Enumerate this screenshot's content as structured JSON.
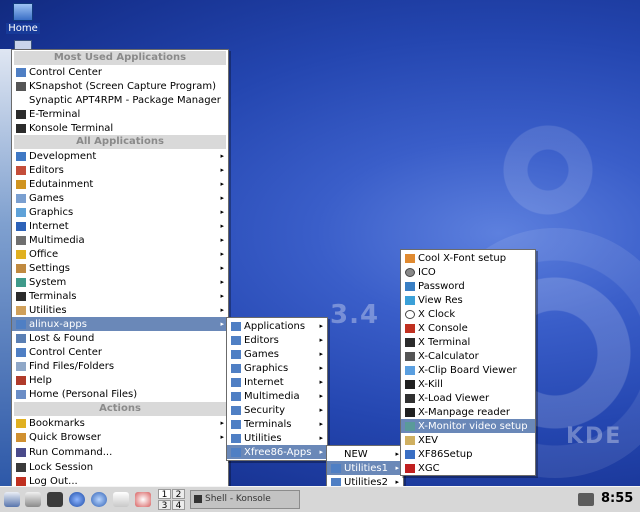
{
  "desktop": {
    "home_icon": "Home",
    "watermark_version": "3.4",
    "watermark_kde": "KDE",
    "brand_strip": "alinux"
  },
  "main_menu": {
    "most_used_title": "Most Used Applications",
    "most_used": [
      {
        "label": "Control Center",
        "icon": "control-center-icon"
      },
      {
        "label": "KSnapshot (Screen Capture Program)",
        "icon": "camera-icon"
      },
      {
        "label": "Synaptic APT4RPM - Package Manager",
        "icon": ""
      },
      {
        "label": "E-Terminal",
        "icon": "terminal-icon"
      },
      {
        "label": "Konsole Terminal",
        "icon": "terminal-icon"
      }
    ],
    "all_title": "All Applications",
    "all": [
      {
        "label": "Development",
        "icon": "development-icon"
      },
      {
        "label": "Editors",
        "icon": "editor-icon"
      },
      {
        "label": "Edutainment",
        "icon": "edutainment-icon"
      },
      {
        "label": "Games",
        "icon": "games-icon"
      },
      {
        "label": "Graphics",
        "icon": "graphics-icon"
      },
      {
        "label": "Internet",
        "icon": "internet-icon"
      },
      {
        "label": "Multimedia",
        "icon": "multimedia-icon"
      },
      {
        "label": "Office",
        "icon": "office-icon"
      },
      {
        "label": "Settings",
        "icon": "settings-icon"
      },
      {
        "label": "System",
        "icon": "system-icon"
      },
      {
        "label": "Terminals",
        "icon": "terminal-icon"
      },
      {
        "label": "Utilities",
        "icon": "utilities-icon"
      },
      {
        "label": "alinux-apps",
        "icon": "folder-icon"
      },
      {
        "label": "Lost & Found",
        "icon": "lost-found-icon"
      }
    ],
    "extra": [
      {
        "label": "Control Center",
        "icon": "control-center-icon"
      },
      {
        "label": "Find Files/Folders",
        "icon": "find-icon"
      },
      {
        "label": "Help",
        "icon": "help-icon"
      },
      {
        "label": "Home (Personal Files)",
        "icon": "home-icon"
      }
    ],
    "actions_title": "Actions",
    "actions": [
      {
        "label": "Bookmarks",
        "icon": "bookmark-icon"
      },
      {
        "label": "Quick Browser",
        "icon": "quick-browser-icon"
      },
      {
        "label": "Run Command...",
        "icon": "run-icon"
      },
      {
        "label": "Lock Session",
        "icon": "lock-icon"
      },
      {
        "label": "Log Out...",
        "icon": "logout-icon"
      }
    ]
  },
  "alinux_apps_menu": [
    "Applications",
    "Editors",
    "Games",
    "Graphics",
    "Internet",
    "Multimedia",
    "Security",
    "Terminals",
    "Utilities",
    "Xfree86-Apps"
  ],
  "xfree_menu": [
    "NEW",
    "Utilities1",
    "Utilities2"
  ],
  "utilities1_menu": [
    {
      "label": "Cool X-Font setup",
      "icon": "font-icon"
    },
    {
      "label": "ICO",
      "icon": "ico-icon"
    },
    {
      "label": "Password",
      "icon": "password-icon"
    },
    {
      "label": "View Res",
      "icon": "view-res-icon"
    },
    {
      "label": "X Clock",
      "icon": "clock-icon"
    },
    {
      "label": "X Console",
      "icon": "console-icon"
    },
    {
      "label": "X Terminal",
      "icon": "terminal-icon"
    },
    {
      "label": "X-Calculator",
      "icon": "calculator-icon"
    },
    {
      "label": "X-Clip Board Viewer",
      "icon": "clipboard-icon"
    },
    {
      "label": "X-Kill",
      "icon": "skull-icon"
    },
    {
      "label": "X-Load Viewer",
      "icon": "load-icon"
    },
    {
      "label": "X-Manpage reader",
      "icon": "manpage-icon"
    },
    {
      "label": "X-Monitor video setup",
      "icon": "monitor-icon"
    },
    {
      "label": "XEV",
      "icon": "xev-icon"
    },
    {
      "label": "XF86Setup",
      "icon": "xf86-icon"
    },
    {
      "label": "XGC",
      "icon": "xgc-icon"
    }
  ],
  "taskbar": {
    "pager": [
      "1",
      "2",
      "3",
      "4"
    ],
    "task": "Shell - Konsole",
    "clock": "8:55"
  },
  "colors": {
    "highlight": "#6a88b8",
    "section_title_bg": "#d9d9d9",
    "desktop": "#2446b0"
  }
}
